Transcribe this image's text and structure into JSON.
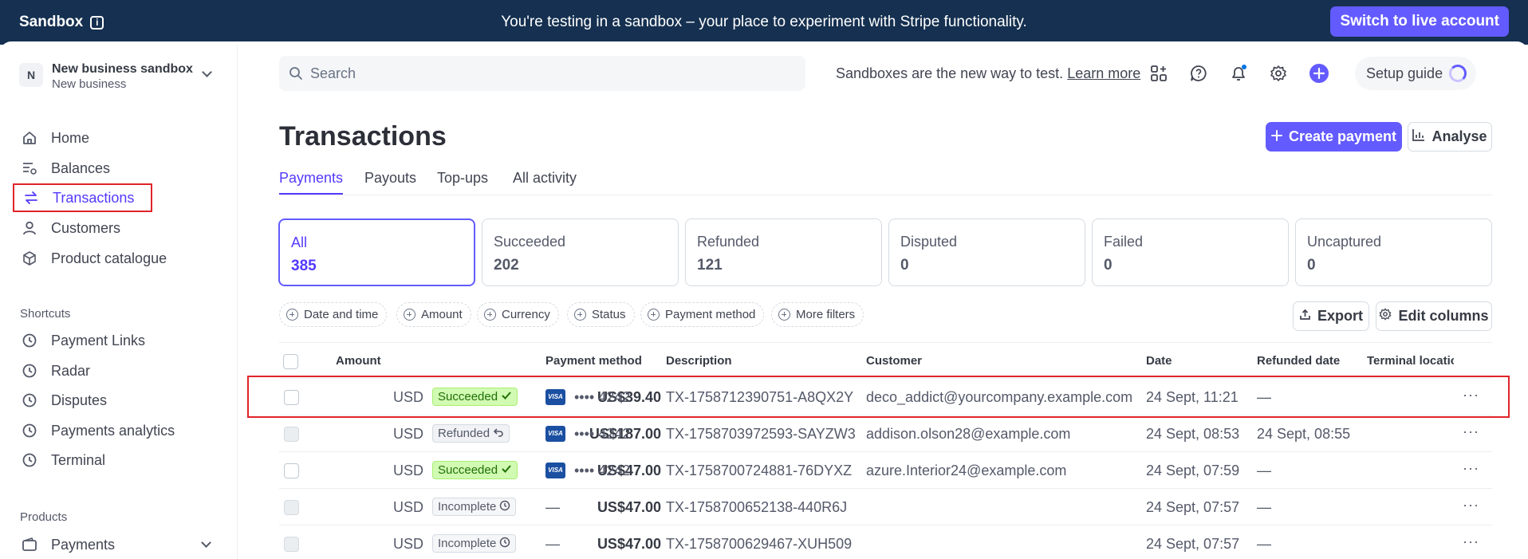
{
  "banner": {
    "brand": "Sandbox",
    "info_icon": "info-icon",
    "message": "You're testing in a sandbox – your place to experiment with Stripe functionality.",
    "live_button": "Switch to live account",
    "bg_color": "#153050",
    "accent": "#635bff"
  },
  "account": {
    "initial": "N",
    "name": "New business sandbox",
    "subtitle": "New business"
  },
  "sidebar": {
    "items": [
      {
        "label": "Home",
        "icon": "home-icon"
      },
      {
        "label": "Balances",
        "icon": "balances-icon"
      },
      {
        "label": "Transactions",
        "icon": "transactions-icon",
        "active": true
      },
      {
        "label": "Customers",
        "icon": "customers-icon"
      },
      {
        "label": "Product catalogue",
        "icon": "product-icon"
      }
    ],
    "shortcuts_label": "Shortcuts",
    "shortcuts": [
      {
        "label": "Payment Links",
        "icon": "clock-icon"
      },
      {
        "label": "Radar",
        "icon": "clock-icon"
      },
      {
        "label": "Disputes",
        "icon": "clock-icon"
      },
      {
        "label": "Payments analytics",
        "icon": "clock-icon"
      },
      {
        "label": "Terminal",
        "icon": "clock-icon"
      }
    ],
    "products_label": "Products",
    "products": [
      {
        "label": "Payments",
        "icon": "wallet-icon"
      }
    ]
  },
  "topbar": {
    "search_placeholder": "Search",
    "sandbox_note": "Sandboxes are the new way to test.",
    "learn_more": "Learn more",
    "setup_guide": "Setup guide"
  },
  "page": {
    "title": "Transactions",
    "create_button": "Create payment",
    "analyse_button": "Analyse",
    "tabs": [
      "Payments",
      "Payouts",
      "Top-ups",
      "All activity"
    ]
  },
  "status_cards": [
    {
      "label": "All",
      "count": "385"
    },
    {
      "label": "Succeeded",
      "count": "202"
    },
    {
      "label": "Refunded",
      "count": "121"
    },
    {
      "label": "Disputed",
      "count": "0"
    },
    {
      "label": "Failed",
      "count": "0"
    },
    {
      "label": "Uncaptured",
      "count": "0"
    }
  ],
  "filters": [
    "Date and time",
    "Amount",
    "Currency",
    "Status",
    "Payment method",
    "More filters"
  ],
  "actions": {
    "export": "Export",
    "edit_columns": "Edit columns"
  },
  "table": {
    "columns": [
      "Amount",
      "Payment method",
      "Description",
      "Customer",
      "Date",
      "Refunded date",
      "Terminal locatio"
    ],
    "rows": [
      {
        "amount": "US$39.40",
        "currency": "USD",
        "status": "Succeeded",
        "card": "•••• 4242",
        "description": "TX-1758712390751-A8QX2Y",
        "customer": "deco_addict@yourcompany.example.com",
        "date": "24 Sept, 11:21",
        "refunded": "—"
      },
      {
        "amount": "US$187.00",
        "currency": "USD",
        "status": "Refunded",
        "card": "•••• 4242",
        "description": "TX-1758703972593-SAYZW3",
        "customer": "addison.olson28@example.com",
        "date": "24 Sept, 08:53",
        "refunded": "24 Sept, 08:55"
      },
      {
        "amount": "US$47.00",
        "currency": "USD",
        "status": "Succeeded",
        "card": "•••• 4242",
        "description": "TX-1758700724881-76DYXZ",
        "customer": "azure.Interior24@example.com",
        "date": "24 Sept, 07:59",
        "refunded": "—"
      },
      {
        "amount": "US$47.00",
        "currency": "USD",
        "status": "Incomplete",
        "card": "—",
        "description": "TX-1758700652138-440R6J",
        "customer": "",
        "date": "24 Sept, 07:57",
        "refunded": "—"
      },
      {
        "amount": "US$47.00",
        "currency": "USD",
        "status": "Incomplete",
        "card": "—",
        "description": "TX-1758700629467-XUH509",
        "customer": "",
        "date": "24 Sept, 07:57",
        "refunded": "—"
      }
    ],
    "card_brand": "VISA"
  }
}
